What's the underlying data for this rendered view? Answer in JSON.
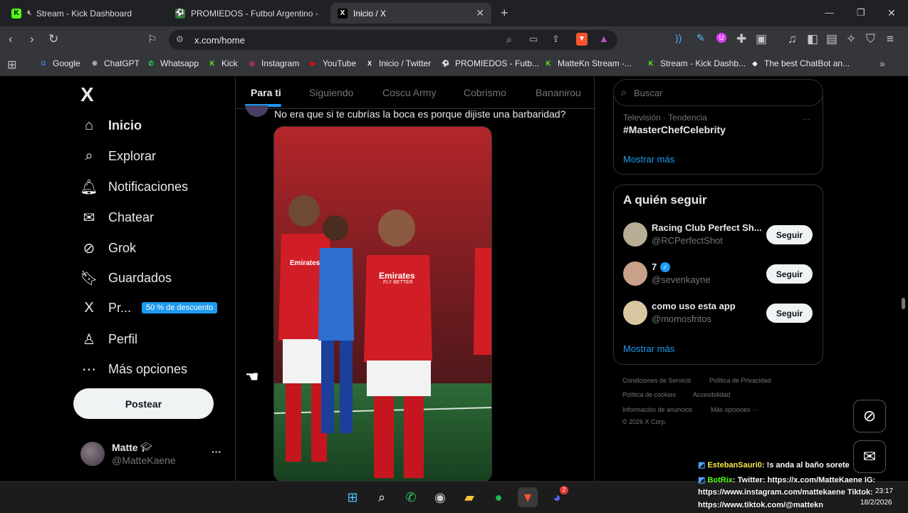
{
  "tabs": [
    {
      "label": "Stream - Kick Dashboard",
      "favicon": "K"
    },
    {
      "label": "PROMIEDOS - Futbol Argentino - Fixt",
      "favicon": "⚽"
    },
    {
      "label": "Inicio / X",
      "favicon": "X"
    }
  ],
  "new_tab": "+",
  "window_controls": {
    "minimize": "—",
    "maximize": "❐",
    "close": "✕"
  },
  "address": "x.com/home",
  "bookmarks": [
    {
      "label": "Google",
      "icon": "G",
      "color": "#4285f4"
    },
    {
      "label": "ChatGPT",
      "icon": "✺",
      "color": "#aaaaaa"
    },
    {
      "label": "Whatsapp",
      "icon": "✆",
      "color": "#25d366"
    },
    {
      "label": "Kick",
      "icon": "K",
      "color": "#53fc18"
    },
    {
      "label": "Instagram",
      "icon": "◎",
      "color": "#e1306c"
    },
    {
      "label": "YouTube",
      "icon": "▶",
      "color": "#ff0000"
    },
    {
      "label": "Inicio / Twitter",
      "icon": "X",
      "color": "#ffffff"
    },
    {
      "label": "PROMIEDOS - Futb...",
      "icon": "⚽",
      "color": "#4caf50"
    },
    {
      "label": "MatteKn Stream -...",
      "icon": "K",
      "color": "#53fc18"
    },
    {
      "label": "Stream - Kick Dashb...",
      "icon": "K",
      "color": "#53fc18"
    },
    {
      "label": "The best ChatBot an...",
      "icon": "◆",
      "color": "#ffffff"
    }
  ],
  "x_logo": "X",
  "nav": [
    {
      "label": "Inicio",
      "icon": "home-icon",
      "glyph": "⌂"
    },
    {
      "label": "Explorar",
      "icon": "search-icon",
      "glyph": "⌕"
    },
    {
      "label": "Notificaciones",
      "icon": "bell-icon",
      "glyph": "🔔︎"
    },
    {
      "label": "Chatear",
      "icon": "mail-icon",
      "glyph": "✉"
    },
    {
      "label": "Grok",
      "icon": "grok-icon",
      "glyph": "⊘"
    },
    {
      "label": "Guardados",
      "icon": "bookmark-icon",
      "glyph": "🔖︎"
    },
    {
      "label": "Pr...",
      "icon": "premium-x-icon",
      "glyph": "X"
    },
    {
      "label": "Perfil",
      "icon": "person-icon",
      "glyph": "♙"
    },
    {
      "label": "Más opciones",
      "icon": "more-circle-icon",
      "glyph": "⋯"
    }
  ],
  "premium_badge": "50 % de descuento",
  "post_button": "Postear",
  "account": {
    "name": "Matte",
    "handle": "@MatteKaene",
    "more": "···"
  },
  "feed_tabs": [
    "Para ti",
    "Siguiendo",
    "Coscu Army",
    "Cobrismo",
    "Bananirou"
  ],
  "post": {
    "text": "No era que si te cubrías la boca es porque dijiste una barbaridad?",
    "jersey_text": "Emirates",
    "jersey_sub": "FLY BETTER"
  },
  "search": {
    "placeholder": "Buscar"
  },
  "trend": {
    "category": "Televisión · Tendencia",
    "name": "#MasterChefCelebrity",
    "more": "···",
    "show_more": "Mostrar más"
  },
  "who_to_follow": {
    "title": "A quién seguir",
    "follow_label": "Seguir",
    "users": [
      {
        "name": "Racing Club Perfect Sh...",
        "handle": "@RCPerfectShot",
        "verified": false
      },
      {
        "name": "7",
        "handle": "@sevenkayne",
        "verified": true
      },
      {
        "name": "como uso esta app",
        "handle": "@momosfritos",
        "verified": false
      }
    ],
    "show_more": "Mostrar más"
  },
  "footer_links": [
    "Condiciones de Servicio",
    "Política de Privacidad",
    "Política de cookies",
    "Accesibilidad",
    "Información de anuncios",
    "Más opciones ···",
    "© 2026 X Corp."
  ],
  "chat_overlay": [
    {
      "user": "EstebanSauri0",
      "text": ": !s anda al baño sorete"
    },
    {
      "user": "BotRix",
      "text": ": Twitter: https://x.com/MatteKaene IG:"
    },
    {
      "user": "",
      "text": "https://www.instagram.com/mattekaene Tiktok:"
    },
    {
      "user": "",
      "text": "https://www.tiktok.com/@mattekn"
    }
  ],
  "clock": {
    "time": "23:17",
    "date": "18/2/2026"
  },
  "taskbar_badge": "2",
  "colors": {
    "accent": "#1d9bf0",
    "kick": "#53fc18",
    "chat_user": "#f5e84b",
    "bot_user": "#53fc18"
  }
}
